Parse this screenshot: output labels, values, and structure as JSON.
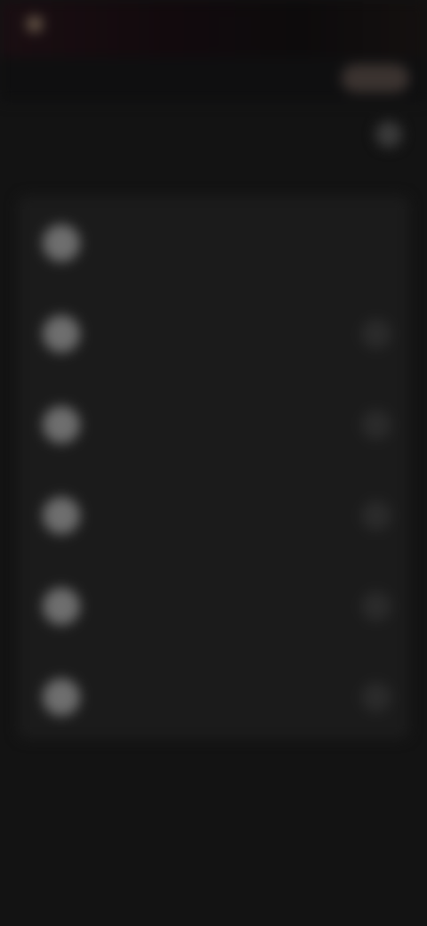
{
  "status_bar": {
    "left_text": "",
    "right_text": ""
  },
  "header": {
    "left_text": "",
    "button_label": ""
  },
  "page": {
    "title": ""
  },
  "list": {
    "items": [
      {
        "title": "",
        "subtitle": ""
      },
      {
        "title": "",
        "subtitle": ""
      },
      {
        "title": "",
        "subtitle": ""
      },
      {
        "title": "",
        "subtitle": ""
      },
      {
        "title": "",
        "subtitle": ""
      },
      {
        "title": "",
        "subtitle": ""
      }
    ]
  },
  "colors": {
    "background": "#131313",
    "card": "#1b1b1b",
    "accent_button": "#3b3330"
  },
  "icons": {
    "status": "status-icon",
    "title_action": "more-icon",
    "avatar": "avatar-icon",
    "row_action": "chevron-right-icon"
  }
}
